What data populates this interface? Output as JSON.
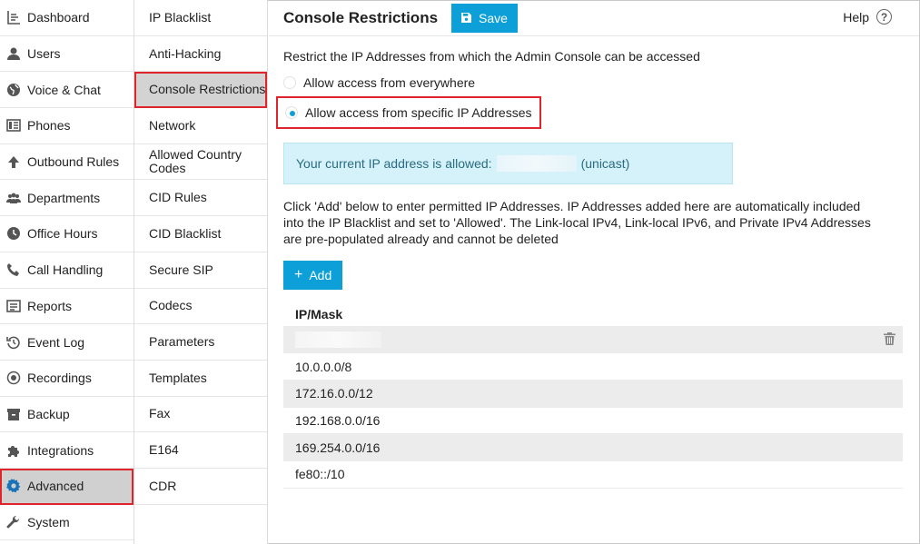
{
  "nav_primary": [
    {
      "label": "Dashboard",
      "icon": "dashboard-icon"
    },
    {
      "label": "Users",
      "icon": "user-icon"
    },
    {
      "label": "Voice & Chat",
      "icon": "globe-icon"
    },
    {
      "label": "Phones",
      "icon": "phone-device-icon"
    },
    {
      "label": "Outbound Rules",
      "icon": "arrow-up-icon"
    },
    {
      "label": "Departments",
      "icon": "group-icon"
    },
    {
      "label": "Office Hours",
      "icon": "clock-icon"
    },
    {
      "label": "Call Handling",
      "icon": "handset-icon"
    },
    {
      "label": "Reports",
      "icon": "report-icon"
    },
    {
      "label": "Event Log",
      "icon": "history-icon"
    },
    {
      "label": "Recordings",
      "icon": "record-icon"
    },
    {
      "label": "Backup",
      "icon": "archive-icon"
    },
    {
      "label": "Integrations",
      "icon": "puzzle-icon"
    },
    {
      "label": "Advanced",
      "icon": "gear-icon",
      "active": true
    },
    {
      "label": "System",
      "icon": "wrench-icon"
    }
  ],
  "nav_secondary": [
    "IP Blacklist",
    "Anti-Hacking",
    "Console Restrictions",
    "Network",
    "Allowed Country Codes",
    "CID Rules",
    "CID Blacklist",
    "Secure SIP",
    "Codecs",
    "Parameters",
    "Templates",
    "Fax",
    "E164",
    "CDR"
  ],
  "nav_secondary_active": "Console Restrictions",
  "header": {
    "title": "Console Restrictions",
    "save_label": "Save",
    "help_label": "Help"
  },
  "main": {
    "description": "Restrict the IP Addresses from which the Admin Console can be accessed",
    "radio_everywhere": "Allow access from everywhere",
    "radio_specific": "Allow access from specific IP Addresses",
    "selected_option": "specific",
    "info_prefix": "Your current IP address is allowed:",
    "info_suffix": "(unicast)",
    "instructions": "Click 'Add' below to enter permitted IP Addresses. IP Addresses added here are automatically included into the IP Blacklist and set to 'Allowed'. The Link-local IPv4, Link-local IPv6, and Private IPv4 Addresses are pre-populated already and cannot be deleted",
    "add_label": "Add",
    "table_header": "IP/Mask",
    "rows": [
      "10.0.0.0/8",
      "172.16.0.0/12",
      "192.168.0.0/16",
      "169.254.0.0/16",
      "fe80::/10"
    ]
  },
  "colors": {
    "accent": "#0d9fd8",
    "highlight_border": "#e0242b",
    "info_bg": "#d5f1f9"
  }
}
